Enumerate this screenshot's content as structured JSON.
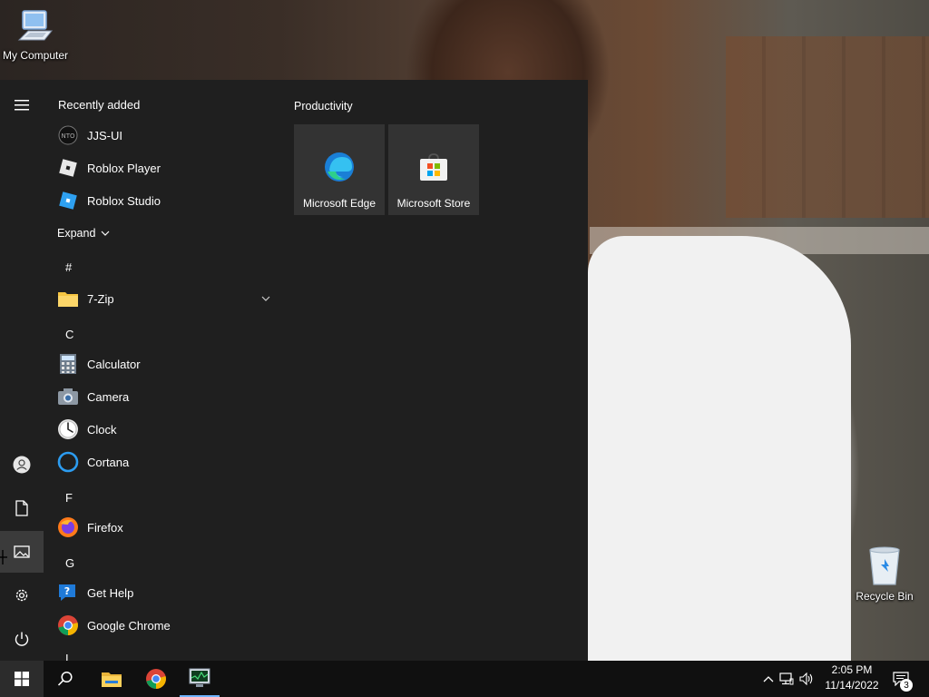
{
  "desktop": {
    "icons": [
      {
        "label": "My Computer"
      },
      {
        "label": "Recycle Bin"
      }
    ]
  },
  "start_menu": {
    "recently_added_header": "Recently added",
    "recent": [
      {
        "label": "JJS-UI",
        "icon": "jjs-ui-icon"
      },
      {
        "label": "Roblox Player",
        "icon": "roblox-player-icon"
      },
      {
        "label": "Roblox Studio",
        "icon": "roblox-studio-icon"
      }
    ],
    "expand_label": "Expand",
    "groups": [
      {
        "letter": "#",
        "apps": [
          {
            "label": "7-Zip",
            "icon": "folder-icon"
          }
        ]
      },
      {
        "letter": "C",
        "apps": [
          {
            "label": "Calculator",
            "icon": "calculator-icon"
          },
          {
            "label": "Camera",
            "icon": "camera-icon"
          },
          {
            "label": "Clock",
            "icon": "clock-icon"
          },
          {
            "label": "Cortana",
            "icon": "cortana-icon"
          }
        ]
      },
      {
        "letter": "F",
        "apps": [
          {
            "label": "Firefox",
            "icon": "firefox-icon"
          }
        ]
      },
      {
        "letter": "G",
        "apps": [
          {
            "label": "Get Help",
            "icon": "get-help-icon"
          },
          {
            "label": "Google Chrome",
            "icon": "chrome-icon"
          }
        ]
      }
    ],
    "next_letter": "I",
    "tiles_group": "Productivity",
    "tiles": [
      {
        "label": "Microsoft Edge",
        "icon": "edge-icon"
      },
      {
        "label": "Microsoft Store",
        "icon": "store-icon"
      }
    ],
    "rail": [
      "hamburger-icon",
      "user-icon",
      "documents-icon",
      "pictures-icon",
      "settings-icon",
      "power-icon"
    ]
  },
  "taskbar": {
    "time": "2:05 PM",
    "date": "11/14/2022",
    "notification_count": "3",
    "apps": [
      "windows-start-icon",
      "search-icon",
      "file-explorer-icon",
      "chrome-icon",
      "task-manager-icon"
    ]
  },
  "colors": {
    "start_bg": "#1f1f1f",
    "tile_bg": "#333333",
    "taskbar_bg": "#101010",
    "accent": "#6fb4ff"
  }
}
